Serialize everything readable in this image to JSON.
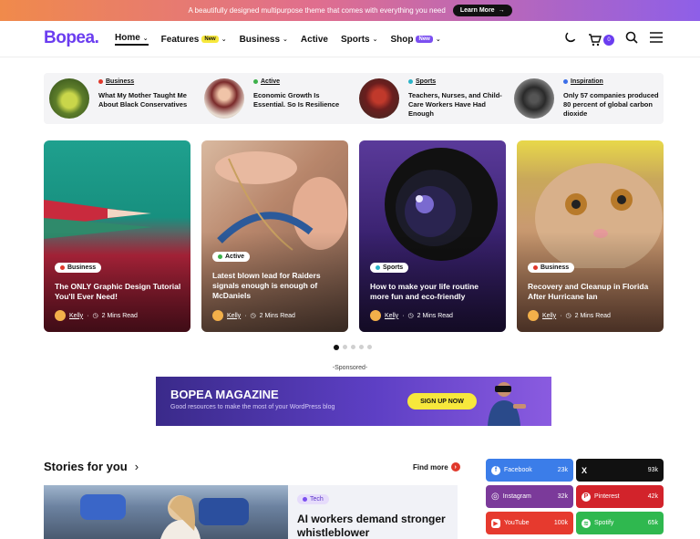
{
  "topbar": {
    "text": "A beautifully designed multipurpose theme that comes with everything you need",
    "button": "Learn More",
    "arrow": "→"
  },
  "header": {
    "logo": "Bopea",
    "nav": [
      {
        "label": "Home",
        "active": true
      },
      {
        "label": "Features",
        "badge": "New"
      },
      {
        "label": "Business"
      },
      {
        "label": "Active"
      },
      {
        "label": "Sports"
      },
      {
        "label": "Shop",
        "badge": "New"
      }
    ],
    "chevron": "⌄",
    "cart_count": "0"
  },
  "mini_posts": [
    {
      "category": "Business",
      "dot": "#e0382b",
      "title": "What My Mother Taught Me About Black Conservatives"
    },
    {
      "category": "Active",
      "dot": "#3cb04a",
      "title": "Economic Growth Is Essential. So Is Resilience"
    },
    {
      "category": "Sports",
      "dot": "#2bb3c8",
      "title": "Teachers, Nurses, and Child-Care Workers Have Had Enough"
    },
    {
      "category": "Inspiration",
      "dot": "#3a6de8",
      "title": "Only 57 companies produced 80 percent of global carbon dioxide"
    }
  ],
  "cards": [
    {
      "category": "Business",
      "dot": "#e0382b",
      "title": "The ONLY Graphic Design Tutorial You'll Ever Need!",
      "author": "Kelly",
      "read": "2 Mins Read"
    },
    {
      "category": "Active",
      "dot": "#3cb04a",
      "title": "Latest blown lead for Raiders signals enough is enough of McDaniels",
      "author": "Kelly",
      "read": "2 Mins Read"
    },
    {
      "category": "Sports",
      "dot": "#2bb3c8",
      "title": "How to make your life routine more fun and eco-friendly",
      "author": "Kelly",
      "read": "2 Mins Read"
    },
    {
      "category": "Business",
      "dot": "#e0382b",
      "title": "Recovery and Cleanup in Florida After Hurricane Ian",
      "author": "Kelly",
      "read": "2 Mins Read"
    }
  ],
  "pager": {
    "count": 5,
    "active": 0
  },
  "sponsored": {
    "label": "-Sponsored-",
    "title": "BOPEA MAGAZINE",
    "subtitle": "Good resources to make the most of your WordPress blog",
    "button": "SIGN UP NOW"
  },
  "stories": {
    "title": "Stories for you",
    "chevron": "›",
    "find_more": "Find more",
    "featured": {
      "category": "Tech",
      "title": "AI workers demand stronger whistleblower"
    }
  },
  "social": [
    {
      "name": "Facebook",
      "count": "23k",
      "color": "#3b7de9",
      "icon": "f"
    },
    {
      "name": "",
      "count": "93k",
      "color": "#111111",
      "icon": "X"
    },
    {
      "name": "Instagram",
      "count": "32k",
      "color": "#7b3a9a",
      "icon": "◎"
    },
    {
      "name": "Pinterest",
      "count": "42k",
      "color": "#d2232b",
      "icon": "P"
    },
    {
      "name": "YouTube",
      "count": "100k",
      "color": "#e63a2e",
      "icon": "▶"
    },
    {
      "name": "Spotify",
      "count": "65k",
      "color": "#2fb84f",
      "icon": "≋"
    }
  ]
}
